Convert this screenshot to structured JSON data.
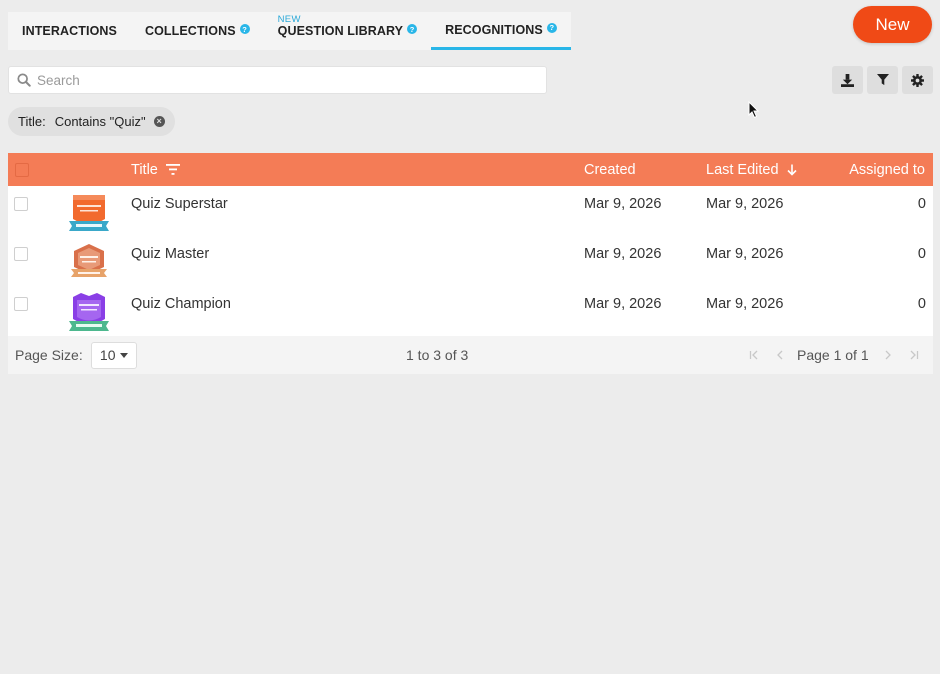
{
  "tabs": [
    {
      "label": "INTERACTIONS",
      "help": false,
      "badge": ""
    },
    {
      "label": "COLLECTIONS",
      "help": true,
      "badge": ""
    },
    {
      "label": "QUESTION LIBRARY",
      "help": true,
      "badge": "NEW"
    },
    {
      "label": "RECOGNITIONS",
      "help": true,
      "badge": "",
      "active": true
    }
  ],
  "help_icon_glyph": "?",
  "new_button": {
    "label": "New",
    "color": "#f04a16"
  },
  "search": {
    "placeholder": "Search",
    "value": ""
  },
  "toolbar": {
    "icons": [
      "download-icon",
      "filter-icon",
      "settings-icon"
    ]
  },
  "filter_chip": {
    "field": "Title:",
    "value": "Contains \"Quiz\"",
    "close_glyph": "×"
  },
  "grid": {
    "header_color": "#f47c56",
    "columns": {
      "title": "Title",
      "created": "Created",
      "last_edited": "Last Edited",
      "assigned_to": "Assigned to"
    },
    "rows": [
      {
        "title": "Quiz Superstar",
        "created": "Mar 9, 2026",
        "last_edited": "Mar 9, 2026",
        "assigned_to": "0",
        "badge_color": "#f26a2e"
      },
      {
        "title": "Quiz Master",
        "created": "Mar 9, 2026",
        "last_edited": "Mar 9, 2026",
        "assigned_to": "0",
        "badge_color": "#d9704a"
      },
      {
        "title": "Quiz Champion",
        "created": "Mar 9, 2026",
        "last_edited": "Mar 9, 2026",
        "assigned_to": "0",
        "badge_color": "#8a3fe6"
      }
    ]
  },
  "pagination": {
    "page_size_label": "Page Size:",
    "page_size": "10",
    "range": "1 to 3 of 3",
    "page_text": "Page 1 of 1"
  }
}
